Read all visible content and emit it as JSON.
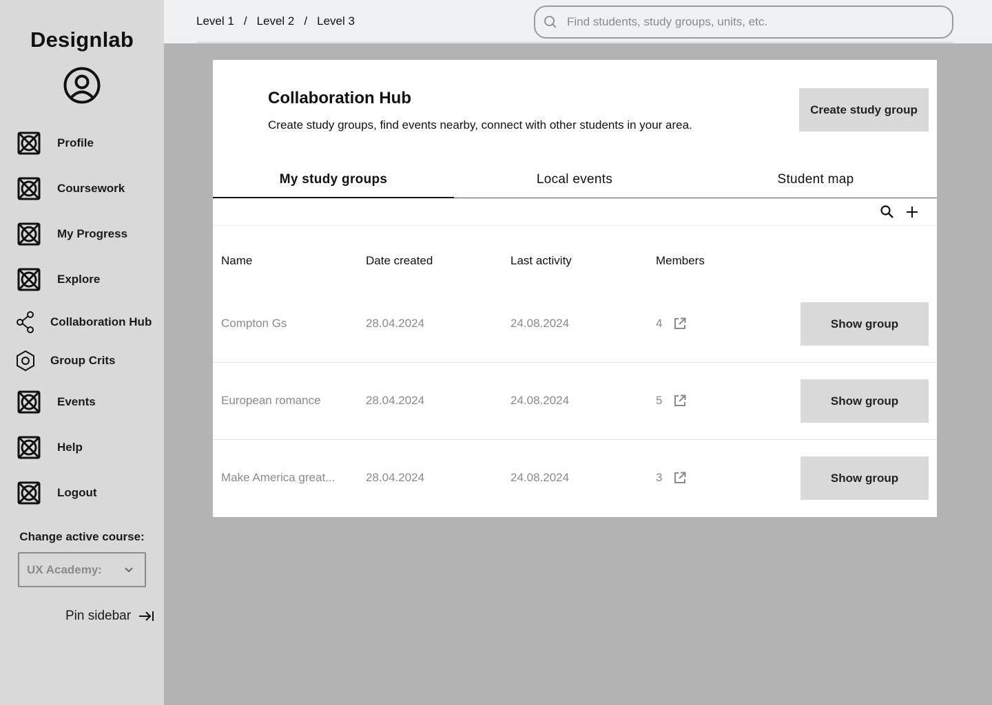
{
  "sidebar": {
    "logo": "Designlab",
    "nav": [
      {
        "label": "Profile",
        "icon": "placeholder-icon"
      },
      {
        "label": "Coursework",
        "icon": "placeholder-icon"
      },
      {
        "label": "My Progress",
        "icon": "placeholder-icon"
      },
      {
        "label": "Explore",
        "icon": "placeholder-icon"
      },
      {
        "label": "Collaboration Hub",
        "icon": "share-icon"
      },
      {
        "label": "Group Crits",
        "icon": "hexagon-icon"
      },
      {
        "label": "Events",
        "icon": "placeholder-icon"
      },
      {
        "label": "Help",
        "icon": "placeholder-icon"
      },
      {
        "label": "Logout",
        "icon": "placeholder-icon"
      }
    ],
    "course_label": "Change active course:",
    "course_value": "UX Academy:",
    "pin_label": "Pin sidebar"
  },
  "header": {
    "breadcrumbs": [
      "Level 1",
      "Level 2",
      "Level 3"
    ],
    "breadcrumb_separator": "/",
    "search_placeholder": "Find students, study groups, units, etc."
  },
  "main": {
    "title": "Collaboration Hub",
    "subtitle": "Create study groups, find events nearby, connect with other students in your area.",
    "create_button": "Create study group",
    "tabs": [
      {
        "label": "My study groups",
        "active": true
      },
      {
        "label": "Local events",
        "active": false
      },
      {
        "label": "Student map",
        "active": false
      }
    ],
    "columns": [
      "Name",
      "Date created",
      "Last activity",
      "Members"
    ],
    "rows": [
      {
        "name": "Compton Gs",
        "created": "28.04.2024",
        "last_activity": "24.08.2024",
        "members": "4",
        "action": "Show group"
      },
      {
        "name": "European romance",
        "created": "28.04.2024",
        "last_activity": "24.08.2024",
        "members": "5",
        "action": "Show group"
      },
      {
        "name": "Make America great...",
        "created": "28.04.2024",
        "last_activity": "24.08.2024",
        "members": "3",
        "action": "Show group"
      }
    ]
  },
  "colors": {
    "sidebar_bg": "#d9d9d9",
    "page_bg": "#b3b3b3",
    "topbar_bg": "#f0f1f3",
    "card_bg": "#ffffff",
    "button_bg": "#d9d9d9",
    "muted_text": "#8a8a8a"
  }
}
